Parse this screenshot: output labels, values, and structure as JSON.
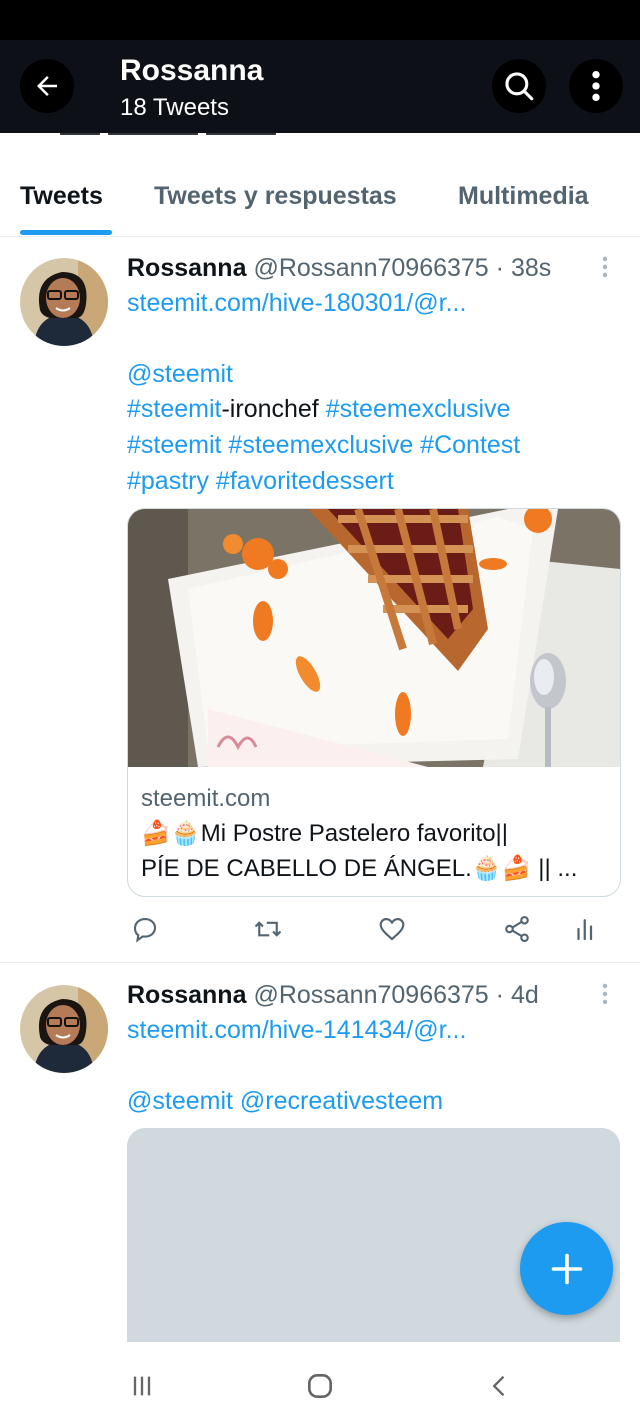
{
  "header": {
    "title": "Rossanna",
    "subtitle": "18 Tweets",
    "back_icon": "arrow-left-icon",
    "search_icon": "search-icon",
    "more_icon": "more-vertical-icon"
  },
  "tabs": [
    {
      "label": "Tweets",
      "active": true
    },
    {
      "label": "Tweets y respuestas",
      "active": false
    },
    {
      "label": "Multimedia",
      "active": false
    }
  ],
  "tweets": [
    {
      "name": "Rossanna",
      "handle": "@Rossann70966375",
      "time": "· 38s",
      "link": "steemit.com/hive-180301/@r...",
      "lines": {
        "l1": "@steemit",
        "l2_a": "#steemit",
        "l2_b": "-ironchef",
        "l2_c": "#steemexclusive",
        "l3": "#steemit #steemexclusive #Contest",
        "l4": "#pastry #favoritedessert"
      },
      "card": {
        "domain": "steemit.com",
        "title_line1": "🍰🧁Mi Postre Pastelero favorito||",
        "title_line2": "PÍE DE CABELLO DE ÁNGEL.🧁🍰 || ..."
      }
    },
    {
      "name": "Rossanna",
      "handle": "@Rossann70966375",
      "time": "· 4d",
      "link": "steemit.com/hive-141434/@r...",
      "mentions": "@steemit @recreativesteem"
    }
  ],
  "actions": [
    "reply-icon",
    "retweet-icon",
    "like-icon",
    "share-icon",
    "analytics-icon"
  ],
  "colors": {
    "accent": "#1d9bf0",
    "header_bg": "#0d1017",
    "text": "#0f1419",
    "muted": "#536471"
  }
}
